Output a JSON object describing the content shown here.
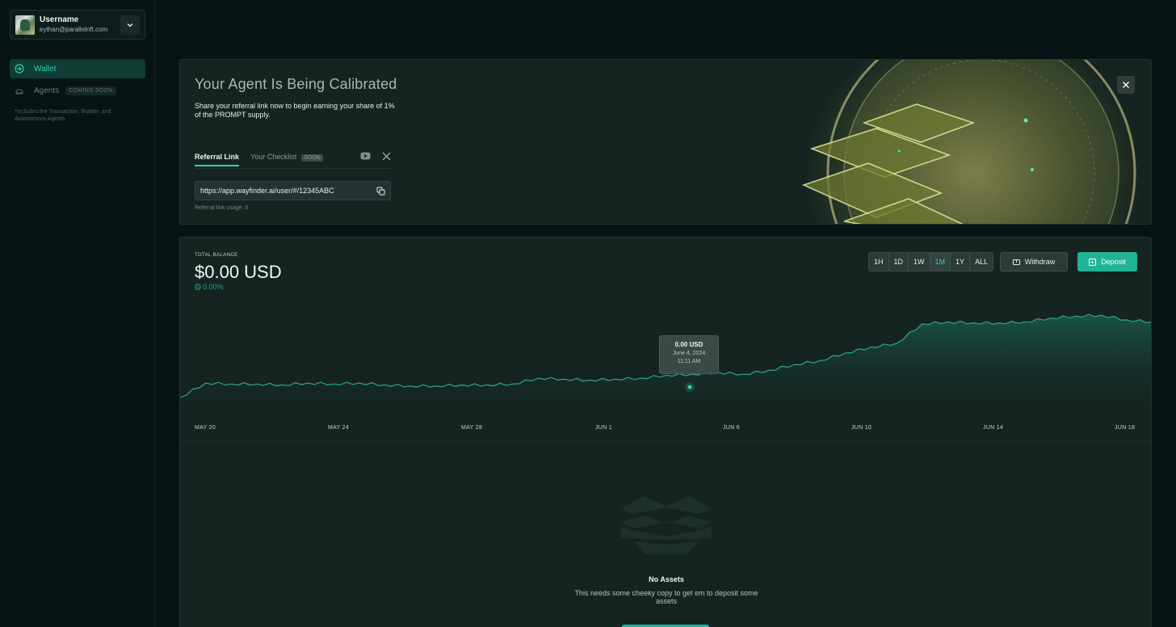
{
  "user": {
    "name": "Username",
    "email": "eythan@parallelnft.com"
  },
  "sidebar": {
    "items": [
      {
        "label": "Wallet",
        "icon": "wallet-icon",
        "active": true
      },
      {
        "label": "Agents",
        "icon": "agents-icon",
        "badge": "COMING SOON"
      }
    ],
    "note": "*Includes the Transaction, Builder, and Autonomous Agents"
  },
  "banner": {
    "title": "Your Agent Is Being Calibrated",
    "description": "Share your referral link now to begin earning your share of 1% of the PROMPT supply.",
    "tabs": [
      {
        "label": "Referral Link",
        "active": true
      },
      {
        "label": "Your Checklist",
        "badge": "SOON"
      }
    ],
    "referral_url": "https://app.wayfinder.ai/user/#/12345ABC",
    "usage": "Referral link usage: 0"
  },
  "balance": {
    "label": "TOTAL BALANCE",
    "amount": "$0.00 USD",
    "change": "0.00%",
    "ranges": [
      "1H",
      "1D",
      "1W",
      "1M",
      "1Y",
      "ALL"
    ],
    "active_range": "1M",
    "withdraw_label": "Withdraw",
    "deposit_label": "Deposit"
  },
  "chart_data": {
    "type": "area",
    "x_ticks": [
      "MAY 20",
      "MAY 24",
      "MAY 28",
      "JUN 1",
      "JUN 6",
      "JUN 10",
      "JUN 14",
      "JUN 18"
    ],
    "series": [
      {
        "values": [
          0.1,
          0.25,
          0.24,
          0.24,
          0.23,
          0.25,
          0.24,
          0.25,
          0.23,
          0.22,
          0.22,
          0.23,
          0.23,
          0.24,
          0.3,
          0.29,
          0.28,
          0.29,
          0.3,
          0.33,
          0.34,
          0.36,
          0.34,
          0.38,
          0.44,
          0.48,
          0.56,
          0.62,
          0.66,
          0.86,
          0.88,
          0.87,
          0.87,
          0.88,
          0.92,
          0.94,
          0.95,
          0.9,
          0.88
        ]
      }
    ],
    "color": "#2ea58a",
    "tooltip": {
      "value": "0.00 USD",
      "date": "June 4, 2024",
      "time": "11:11 AM"
    }
  },
  "empty_state": {
    "title": "No Assets",
    "description": "This needs some cheeky copy to get em to deposit some assets"
  },
  "colors": {
    "accent": "#1fb497",
    "background": "#071413",
    "card": "#152421"
  }
}
